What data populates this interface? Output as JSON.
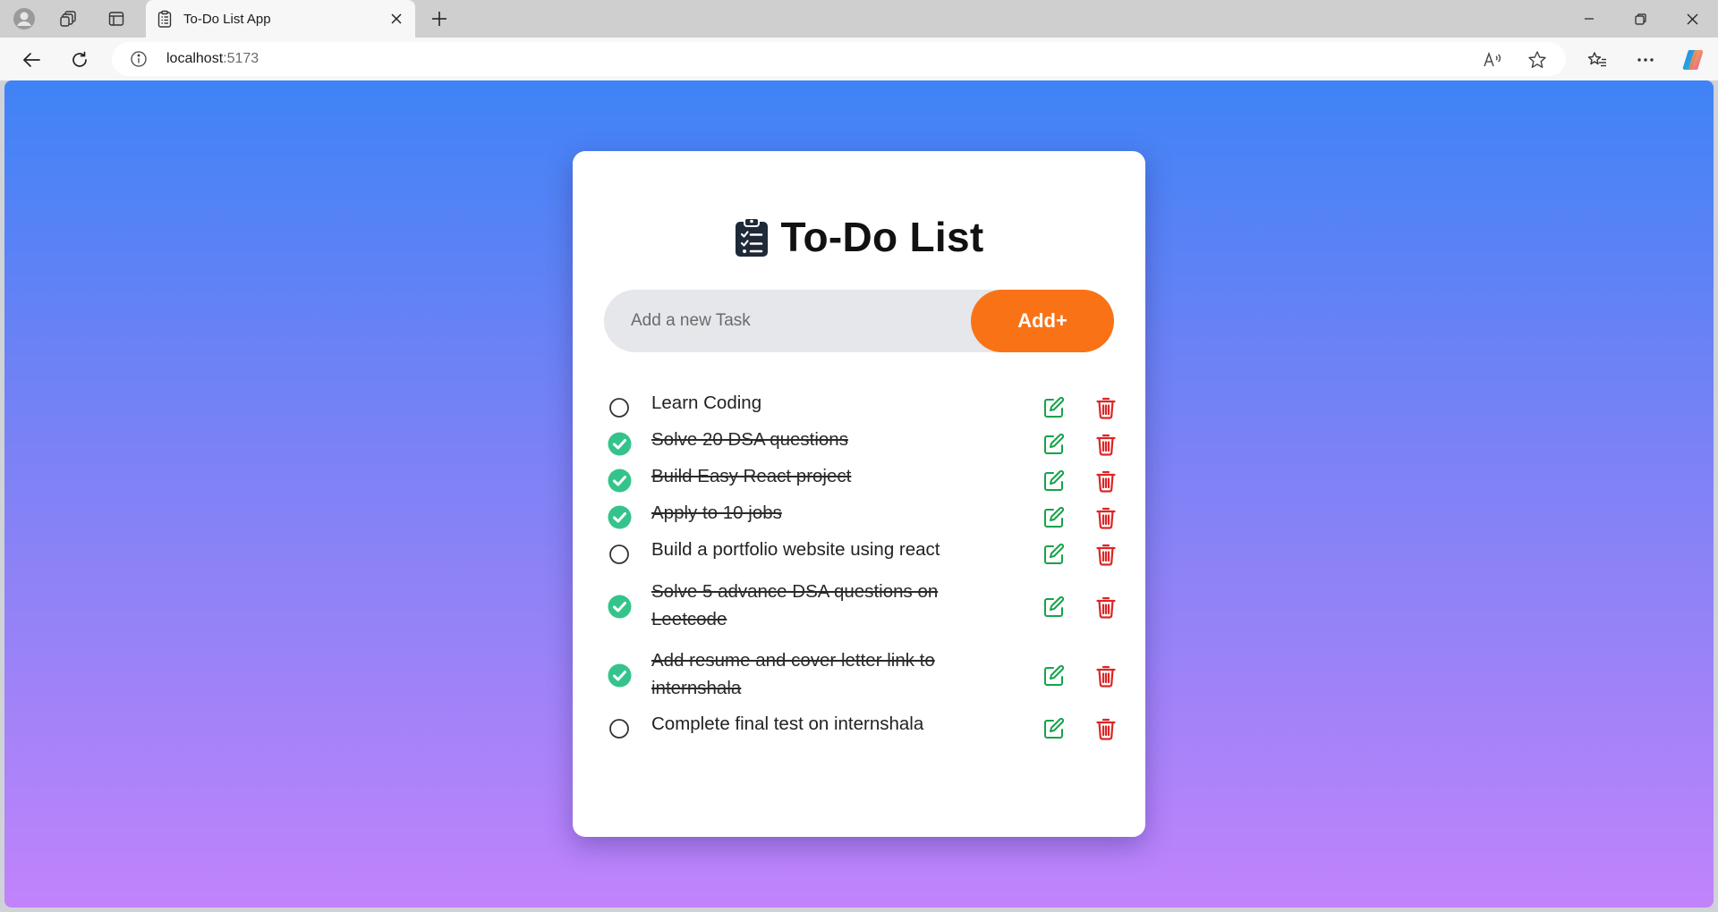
{
  "browser": {
    "tab_title": "To-Do List App",
    "url_host": "localhost",
    "url_port": ":5173"
  },
  "app": {
    "title": "To-Do List",
    "input_placeholder": "Add a new Task",
    "input_value": "",
    "add_label": "Add+",
    "colors": {
      "accent": "#f97316",
      "done_check": "#34c48b",
      "edit_icon": "#16a34a",
      "delete_icon": "#dc2626"
    },
    "tasks": [
      {
        "text": "Learn Coding",
        "completed": false
      },
      {
        "text": "Solve 20 DSA questions",
        "completed": true
      },
      {
        "text": "Build Easy React project",
        "completed": true
      },
      {
        "text": "Apply to 10 jobs",
        "completed": true
      },
      {
        "text": "Build a portfolio website using react",
        "completed": false
      },
      {
        "text": "Solve 5 advance DSA questions on Leetcode",
        "completed": true
      },
      {
        "text": "Add resume and cover letter link to internshala",
        "completed": true
      },
      {
        "text": "Complete final test on internshala",
        "completed": false
      }
    ]
  }
}
